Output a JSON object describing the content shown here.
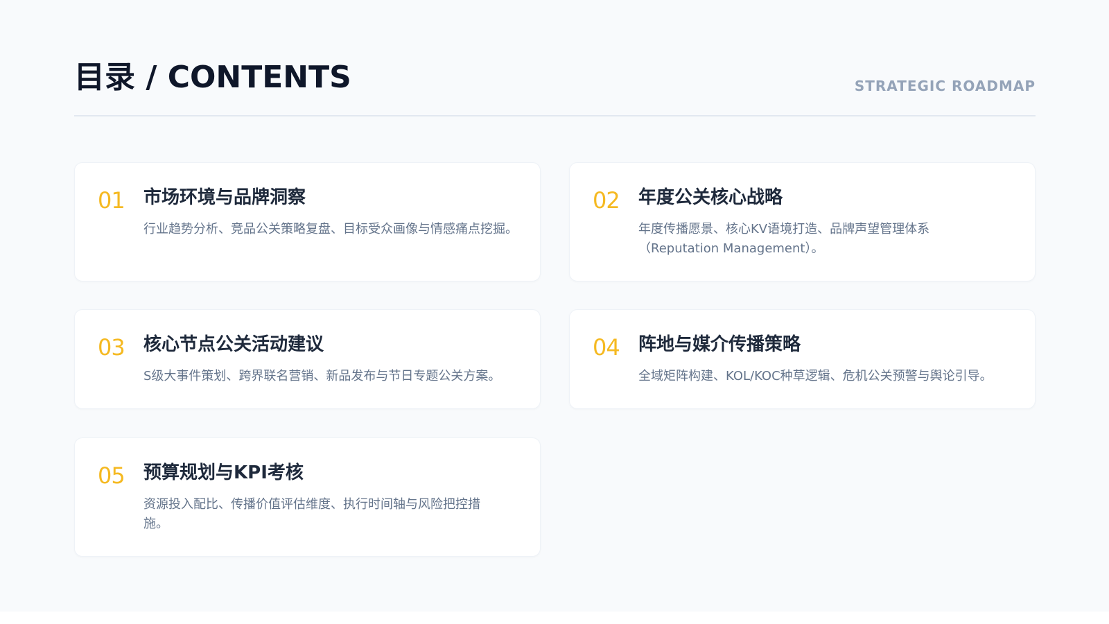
{
  "header": {
    "title": "目录 / CONTENTS",
    "subtitle": "STRATEGIC ROADMAP"
  },
  "colors": {
    "accent": "#f5b921",
    "title": "#0f172a",
    "text_muted": "#64748b",
    "background": "#f8fafc"
  },
  "items": [
    {
      "number": "01",
      "title": "市场环境与品牌洞察",
      "description": "行业趋势分析、竞品公关策略复盘、目标受众画像与情感痛点挖掘。"
    },
    {
      "number": "02",
      "title": "年度公关核心战略",
      "description": "年度传播愿景、核心KV语境打造、品牌声望管理体系（Reputation Management）。"
    },
    {
      "number": "03",
      "title": "核心节点公关活动建议",
      "description": "S级大事件策划、跨界联名营销、新品发布与节日专题公关方案。"
    },
    {
      "number": "04",
      "title": "阵地与媒介传播策略",
      "description": "全域矩阵构建、KOL/KOC种草逻辑、危机公关预警与舆论引导。"
    },
    {
      "number": "05",
      "title": "预算规划与KPI考核",
      "description": "资源投入配比、传播价值评估维度、执行时间轴与风险把控措施。"
    }
  ]
}
